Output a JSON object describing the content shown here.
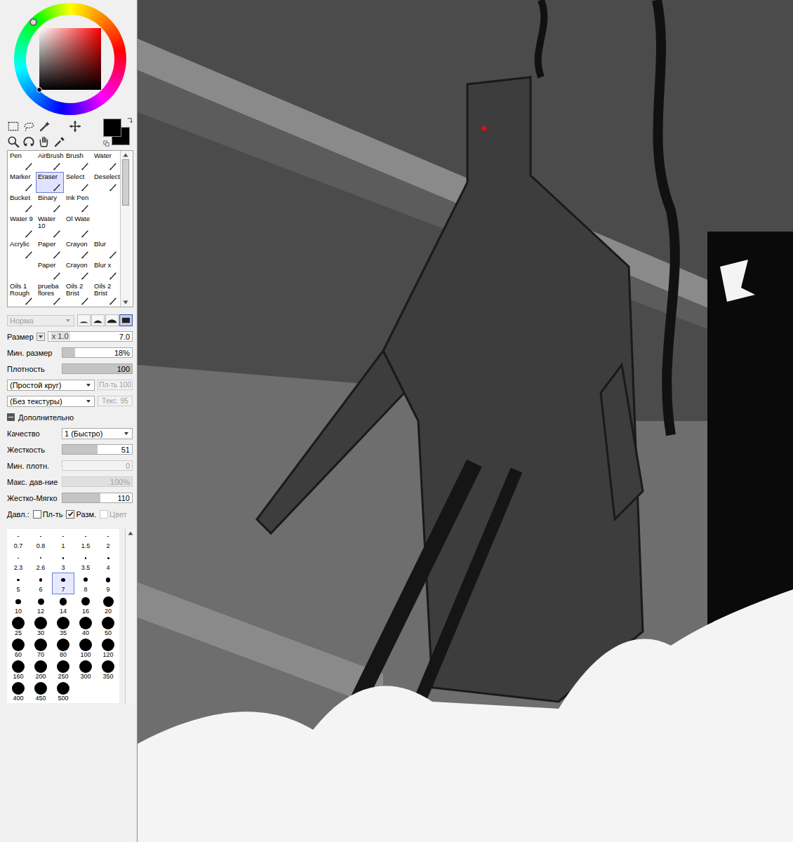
{
  "colors": {
    "foreground": "#000000",
    "background": "#000000"
  },
  "tools": [
    {
      "label": "Pen",
      "selected": false
    },
    {
      "label": "AirBrush",
      "selected": false
    },
    {
      "label": "Brush",
      "selected": false
    },
    {
      "label": "Water",
      "selected": false
    },
    {
      "label": "Marker",
      "selected": false
    },
    {
      "label": "Eraser",
      "selected": true
    },
    {
      "label": "Select",
      "selected": false
    },
    {
      "label": "Deselect",
      "selected": false
    },
    {
      "label": "Bucket",
      "selected": false
    },
    {
      "label": "Binary",
      "selected": false
    },
    {
      "label": "Ink Pen",
      "selected": false
    },
    {
      "label": "",
      "selected": false
    },
    {
      "label": "Water 9",
      "selected": false
    },
    {
      "label": "Water 10",
      "selected": false
    },
    {
      "label": "Ol Wate",
      "selected": false
    },
    {
      "label": "",
      "selected": false
    },
    {
      "label": "Acrylic",
      "selected": false
    },
    {
      "label": "Paper",
      "selected": false
    },
    {
      "label": "Crayon",
      "selected": false
    },
    {
      "label": "Blur",
      "selected": false
    },
    {
      "label": "",
      "selected": false
    },
    {
      "label": "Paper",
      "selected": false
    },
    {
      "label": "Crayon",
      "selected": false
    },
    {
      "label": "Blur x",
      "selected": false
    },
    {
      "label": "Oils 1 Rough",
      "selected": false
    },
    {
      "label": "prueba flores",
      "selected": false
    },
    {
      "label": "Oils 2 Brist",
      "selected": false
    },
    {
      "label": "Oils 2 Brist",
      "selected": false
    }
  ],
  "blend_mode": {
    "value": "Норма",
    "disabled": true
  },
  "brush_shapes": [
    {
      "kind": "flat",
      "selected": false
    },
    {
      "kind": "dome",
      "selected": false
    },
    {
      "kind": "round",
      "selected": false
    },
    {
      "kind": "square",
      "selected": true
    }
  ],
  "size": {
    "label": "Размер",
    "multiplier": "x 1.0",
    "value": "7.0"
  },
  "sliders": [
    {
      "label": "Мин. размер",
      "value": "18%",
      "level": 0.18,
      "disabled": false
    },
    {
      "label": "Плотность",
      "value": "100",
      "level": 1,
      "disabled": false
    }
  ],
  "shape": {
    "value": "(Простой круг)",
    "strength": "Пл-ть 100",
    "disabled": true
  },
  "texture": {
    "value": "(Без текстуры)",
    "strength": "Текс. 95",
    "disabled": true
  },
  "advanced": {
    "label": "Дополнительно",
    "expanded": true,
    "quality": {
      "label": "Качество",
      "value": "1 (Быстро)"
    },
    "sliders": [
      {
        "label": "Жесткость",
        "value": "51",
        "level": 0.51,
        "disabled": false
      },
      {
        "label": "Мин. плотн.",
        "value": "0",
        "level": 0,
        "disabled": true
      },
      {
        "label": "Макс. дав-ние",
        "value": "100%",
        "level": 1,
        "disabled": true
      },
      {
        "label": "Жестко-Мягко",
        "value": "110",
        "level": 0.55,
        "disabled": false
      }
    ],
    "pressure": {
      "label": "Давл.:",
      "options": [
        {
          "label": "Пл-ть",
          "checked": false,
          "disabled": false
        },
        {
          "label": "Разм.",
          "checked": true,
          "disabled": false
        },
        {
          "label": "Цвет",
          "checked": false,
          "disabled": true
        }
      ]
    }
  },
  "brush_sizes": [
    {
      "label": "0.7",
      "selected": false
    },
    {
      "label": "0.8",
      "selected": false
    },
    {
      "label": "1",
      "selected": false
    },
    {
      "label": "1.5",
      "selected": false
    },
    {
      "label": "2",
      "selected": false
    },
    {
      "label": "2.3",
      "selected": false
    },
    {
      "label": "2.6",
      "selected": false
    },
    {
      "label": "3",
      "selected": false
    },
    {
      "label": "3.5",
      "selected": false
    },
    {
      "label": "4",
      "selected": false
    },
    {
      "label": "5",
      "selected": false
    },
    {
      "label": "6",
      "selected": false
    },
    {
      "label": "7",
      "selected": true
    },
    {
      "label": "8",
      "selected": false
    },
    {
      "label": "9",
      "selected": false
    },
    {
      "label": "10",
      "selected": false
    },
    {
      "label": "12",
      "selected": false
    },
    {
      "label": "14",
      "selected": false
    },
    {
      "label": "16",
      "selected": false
    },
    {
      "label": "20",
      "selected": false
    },
    {
      "label": "25",
      "selected": false
    },
    {
      "label": "30",
      "selected": false
    },
    {
      "label": "35",
      "selected": false
    },
    {
      "label": "40",
      "selected": false
    },
    {
      "label": "50",
      "selected": false
    },
    {
      "label": "60",
      "selected": false
    },
    {
      "label": "70",
      "selected": false
    },
    {
      "label": "80",
      "selected": false
    },
    {
      "label": "100",
      "selected": false
    },
    {
      "label": "120",
      "selected": false
    },
    {
      "label": "160",
      "selected": false
    },
    {
      "label": "200",
      "selected": false
    },
    {
      "label": "250",
      "selected": false
    },
    {
      "label": "300",
      "selected": false
    },
    {
      "label": "350",
      "selected": false
    },
    {
      "label": "400",
      "selected": false
    },
    {
      "label": "450",
      "selected": false
    },
    {
      "label": "500",
      "selected": false
    }
  ]
}
